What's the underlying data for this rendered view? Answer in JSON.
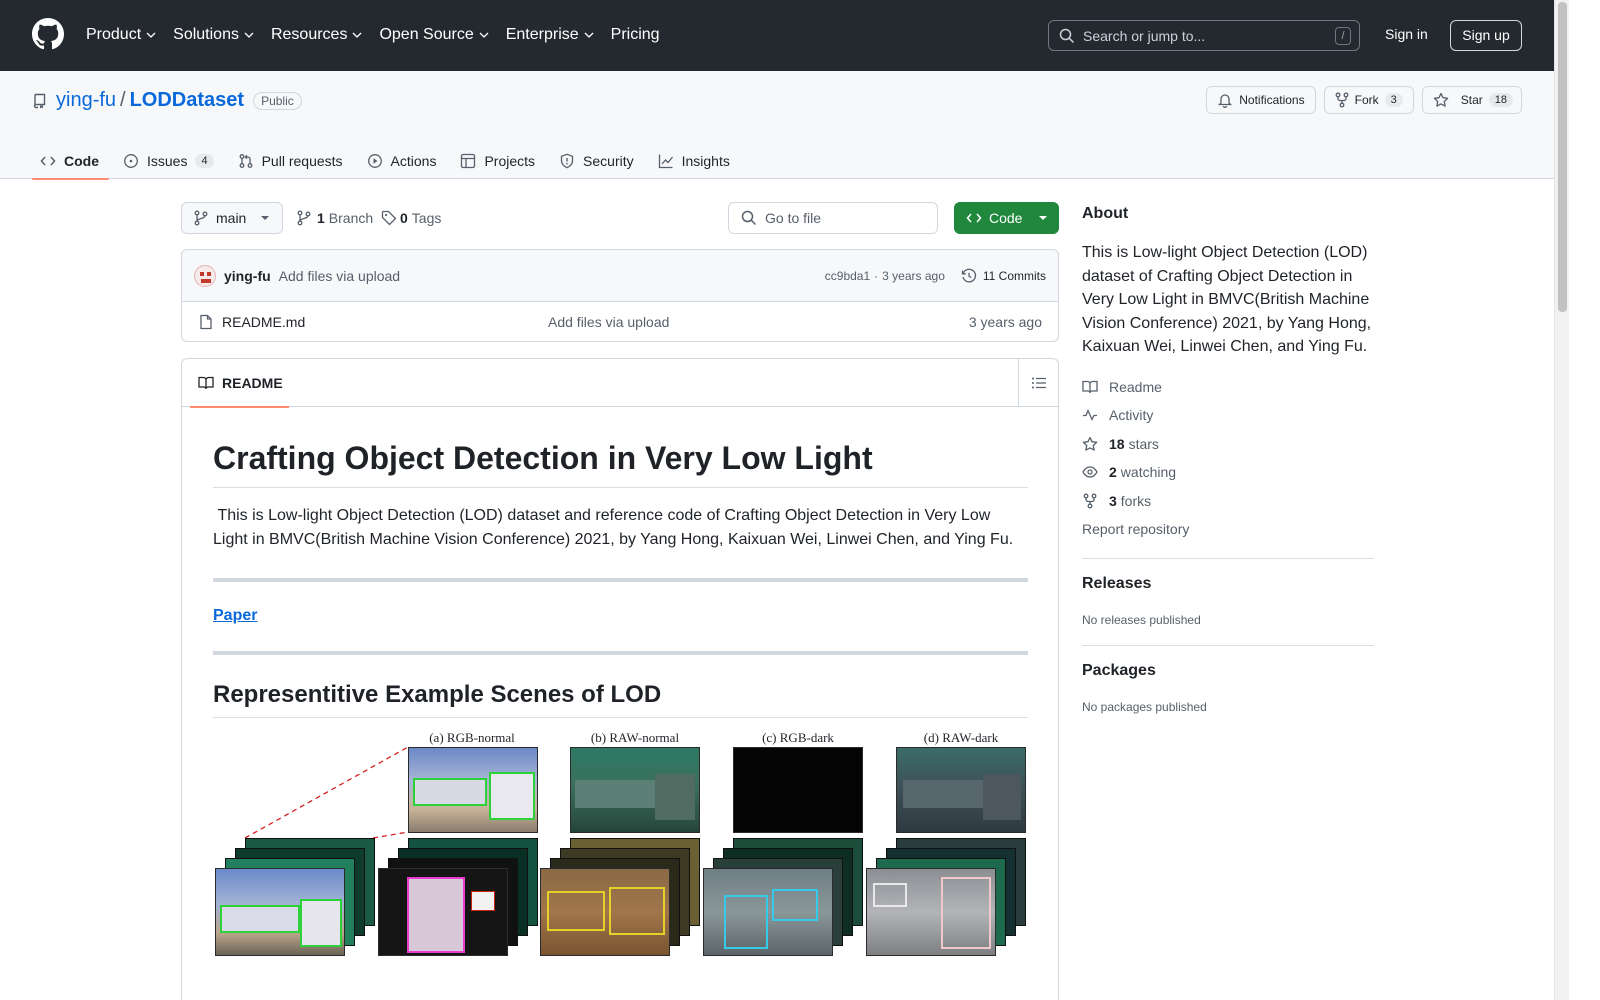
{
  "header": {
    "nav": [
      {
        "label": "Product",
        "has_menu": true
      },
      {
        "label": "Solutions",
        "has_menu": true
      },
      {
        "label": "Resources",
        "has_menu": true
      },
      {
        "label": "Open Source",
        "has_menu": true
      },
      {
        "label": "Enterprise",
        "has_menu": true
      },
      {
        "label": "Pricing",
        "has_menu": false
      }
    ],
    "search_placeholder": "Search or jump to...",
    "search_shortcut": "/",
    "sign_in": "Sign in",
    "sign_up": "Sign up"
  },
  "repo": {
    "owner": "ying-fu",
    "separator": "/",
    "name": "LODDataset",
    "visibility": "Public",
    "notifications_label": "Notifications",
    "fork_label": "Fork",
    "fork_count": "3",
    "star_label": "Star",
    "star_count": "18"
  },
  "tabs": [
    {
      "label": "Code",
      "icon": "code-icon",
      "active": true
    },
    {
      "label": "Issues",
      "icon": "issue-icon",
      "count": "4"
    },
    {
      "label": "Pull requests",
      "icon": "pull-request-icon"
    },
    {
      "label": "Actions",
      "icon": "play-icon"
    },
    {
      "label": "Projects",
      "icon": "table-icon"
    },
    {
      "label": "Security",
      "icon": "shield-icon"
    },
    {
      "label": "Insights",
      "icon": "graph-icon"
    }
  ],
  "branchbar": {
    "branch": "main",
    "branch_count": "1",
    "branch_label": "Branch",
    "tag_count": "0",
    "tag_label": "Tags",
    "goto_placeholder": "Go to file",
    "code_button": "Code"
  },
  "commit": {
    "author": "ying-fu",
    "message": "Add files via upload",
    "hash": "cc9bda1",
    "dot": "·",
    "age": "3 years ago",
    "commits_label": "11 Commits"
  },
  "files": [
    {
      "name": "README.md",
      "message": "Add files via upload",
      "age": "3 years ago"
    }
  ],
  "readme": {
    "tab_label": "README",
    "title": "Crafting Object Detection in Very Low Light",
    "intro": " This is Low-light Object Detection (LOD) dataset and reference code of Crafting Object Detection in Very Low Light in BMVC(British Machine Vision Conference) 2021, by Yang Hong, Kaixuan Wei, Linwei Chen, and Ying Fu.",
    "paper_link": "Paper",
    "section_title": "Representitive Example Scenes of LOD",
    "figure_labels": [
      "(a) RGB-normal",
      "(b) RAW-normal",
      "(c) RGB-dark",
      "(d) RAW-dark"
    ]
  },
  "about": {
    "heading": "About",
    "description": "This is Low-light Object Detection (LOD) dataset of Crafting Object Detection in Very Low Light in BMVC(British Machine Vision Conference) 2021, by Yang Hong, Kaixuan Wei, Linwei Chen, and Ying Fu.",
    "items": [
      {
        "icon": "book-icon",
        "label": "Readme"
      },
      {
        "icon": "pulse-icon",
        "label": "Activity"
      },
      {
        "icon": "star-icon",
        "count": "18",
        "label": "stars"
      },
      {
        "icon": "eye-icon",
        "count": "2",
        "label": "watching"
      },
      {
        "icon": "fork-icon",
        "count": "3",
        "label": "forks"
      }
    ],
    "report": "Report repository"
  },
  "releases": {
    "heading": "Releases",
    "text": "No releases published"
  },
  "packages": {
    "heading": "Packages",
    "text": "No packages published"
  },
  "colors": {
    "header_bg": "#24292f",
    "link": "#0969da",
    "primary_button": "#1f883d",
    "active_tab_underline": "#fd8c73"
  }
}
